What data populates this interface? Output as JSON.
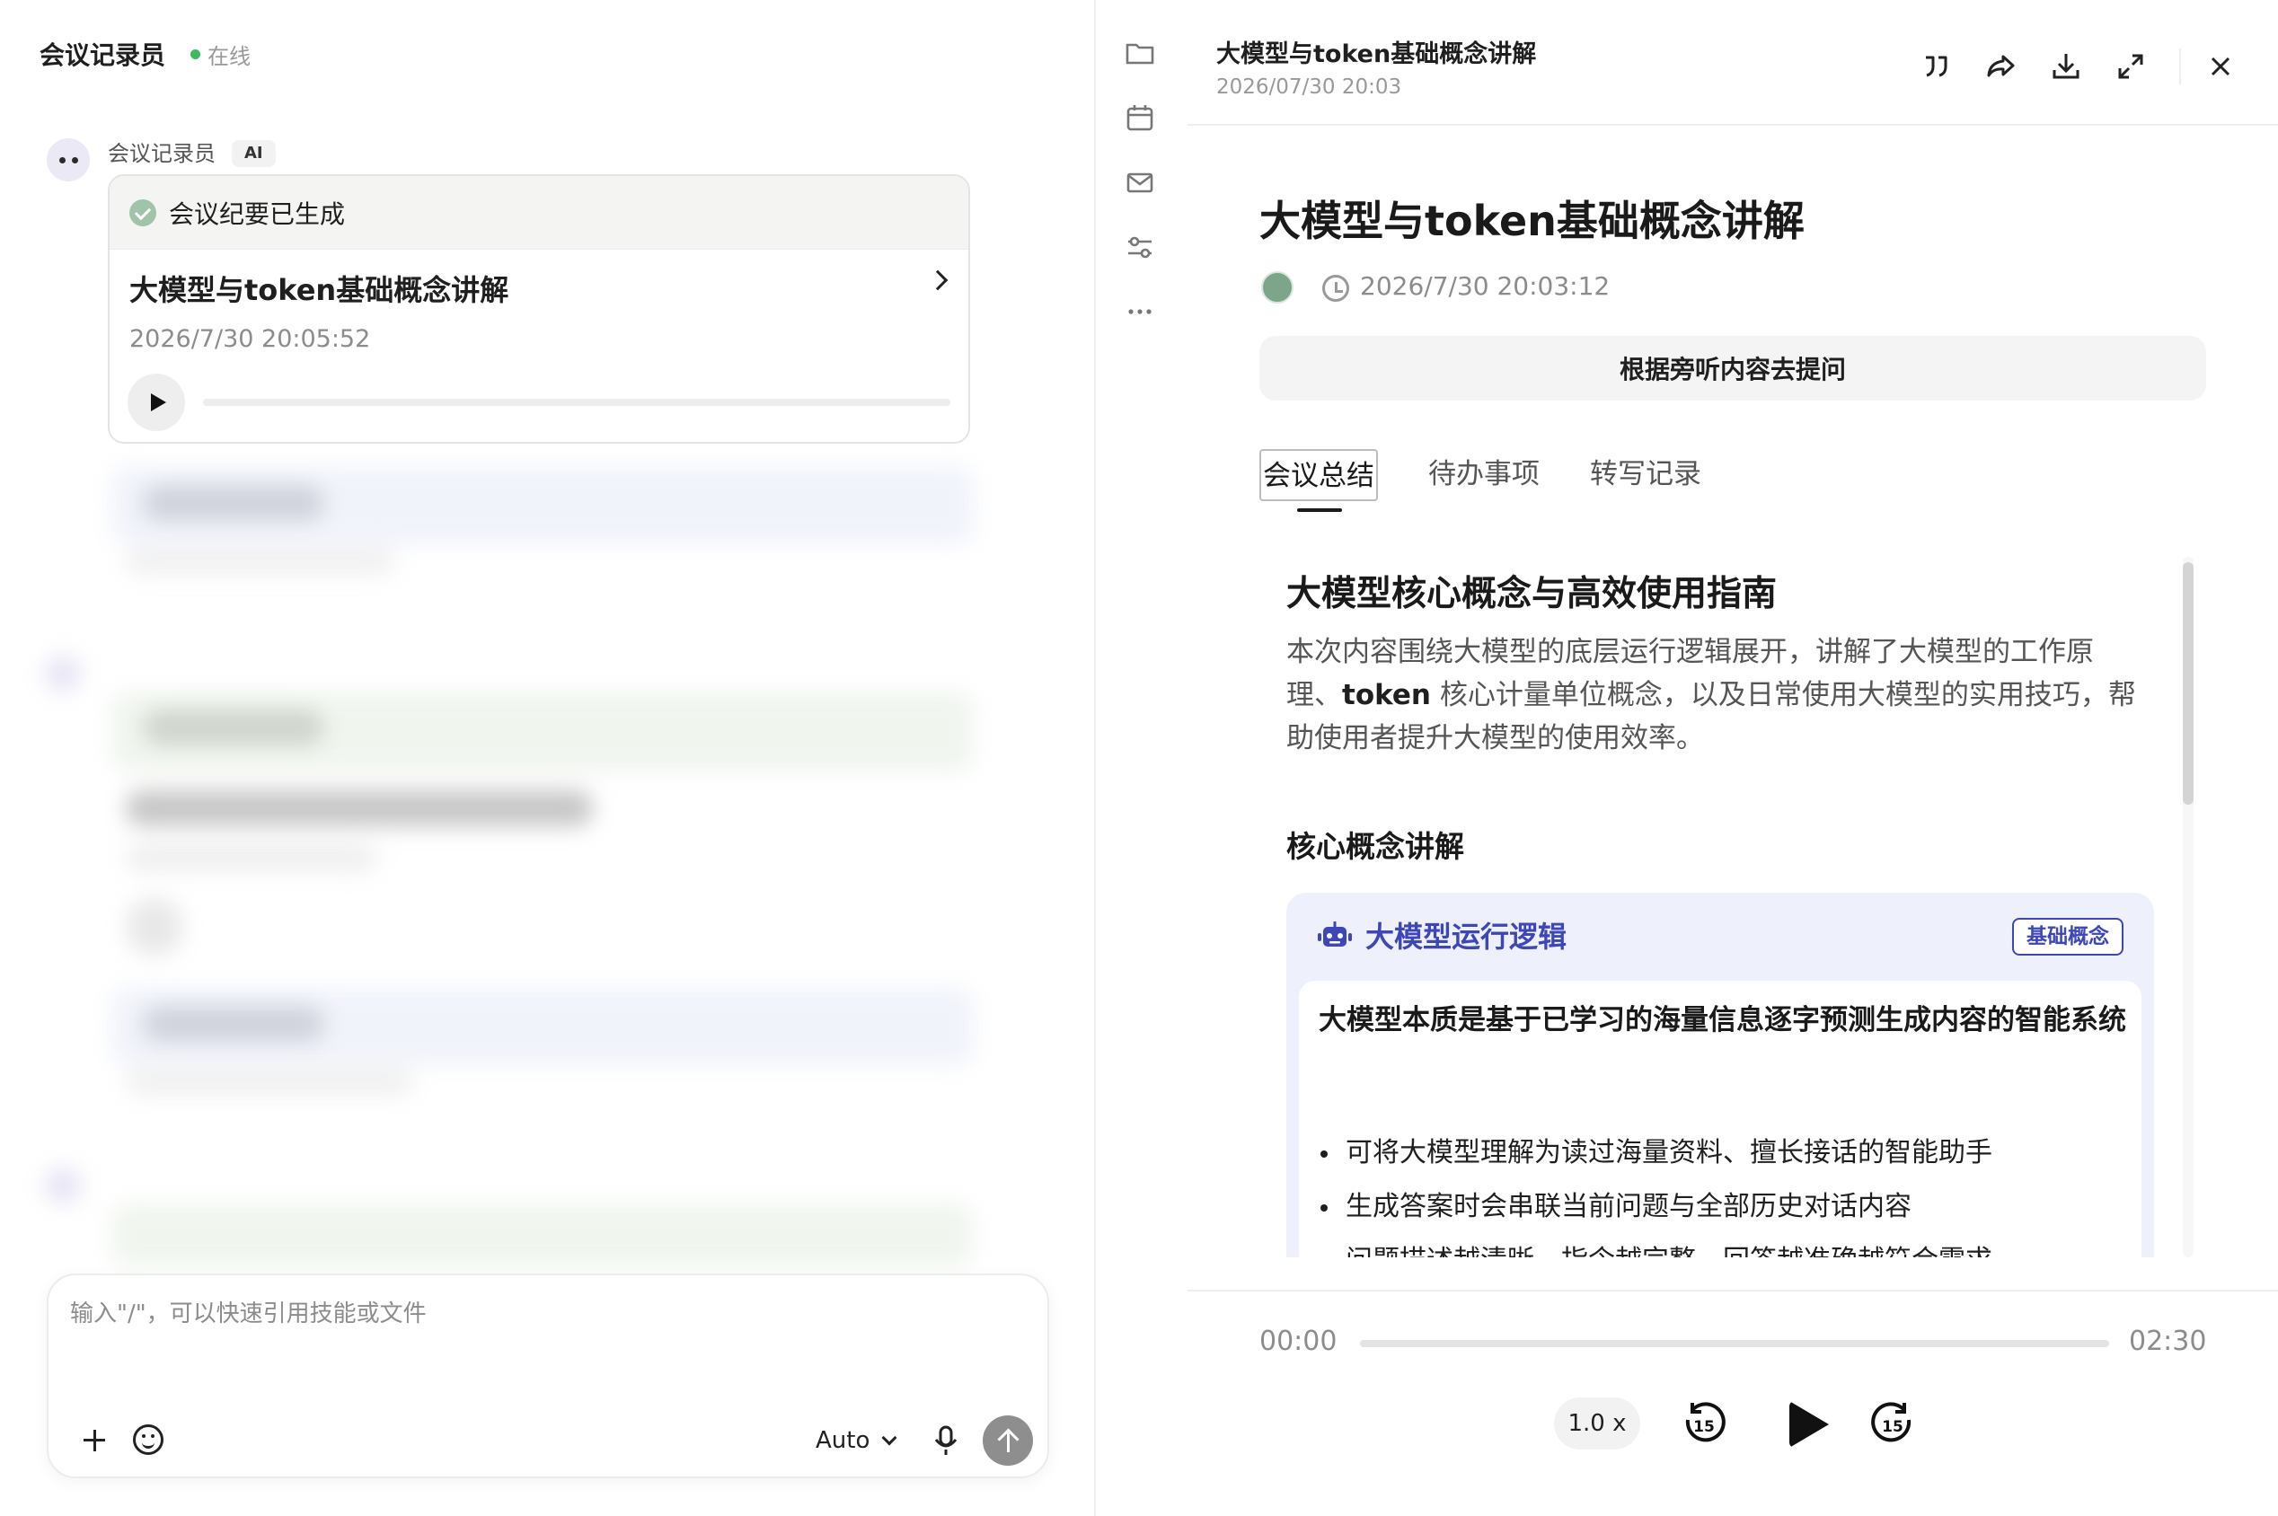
{
  "left": {
    "title": "会议记录员",
    "status": "在线",
    "bot_name": "会议记录员",
    "ai_badge": "AI",
    "card": {
      "status": "会议纪要已生成",
      "title": "大模型与token基础概念讲解",
      "time": "2026/7/30 20:05:52"
    },
    "composer": {
      "placeholder": "输入\"/\"，可以快速引用技能或文件",
      "model": "Auto"
    }
  },
  "rail": {
    "icons": [
      "folder-icon",
      "calendar-icon",
      "mail-icon",
      "sliders-icon",
      "more-icon"
    ]
  },
  "detail": {
    "header_title": "大模型与token基础概念讲解",
    "header_time": "2026/07/30 20:03",
    "header_icons": [
      "quote-icon",
      "share-icon",
      "download-icon",
      "expand-icon",
      "close-icon"
    ],
    "doc_title": "大模型与token基础概念讲解",
    "doc_time": "2026/7/30 20:03:12",
    "ask_label": "根据旁听内容去提问",
    "tabs": [
      "会议总结",
      "待办事项",
      "转写记录"
    ],
    "summary_title": "大模型核心概念与高效使用指南",
    "summary_body_1": "本次内容围绕大模型的底层运行逻辑展开，讲解了大模型的工作原理、",
    "summary_body_token": "token",
    "summary_body_2": " 核心计量单位概念，以及日常使用大模型的实用技巧，帮助使用者提升大模型的使用效率。",
    "core_title": "核心概念讲解",
    "concept": {
      "title": "大模型运行逻辑",
      "tag": "基础概念",
      "lead": "大模型本质是基于已学习的海量信息逐字预测生成内容的智能系统",
      "bullets": [
        "可将大模型理解为读过海量资料、擅长接话的智能助手",
        "生成答案时会串联当前问题与全部历史对话内容",
        "问题描述越清晰，指令越完整，回答越准确越符合需求"
      ]
    },
    "player": {
      "current": "00:00",
      "duration": "02:30",
      "progress": 0,
      "speed": "1.0 x",
      "skip_seconds": "15"
    }
  },
  "colors": {
    "accent": "#3d47b8",
    "online": "#3cba5c",
    "concept_bg": "#eef1fc"
  }
}
